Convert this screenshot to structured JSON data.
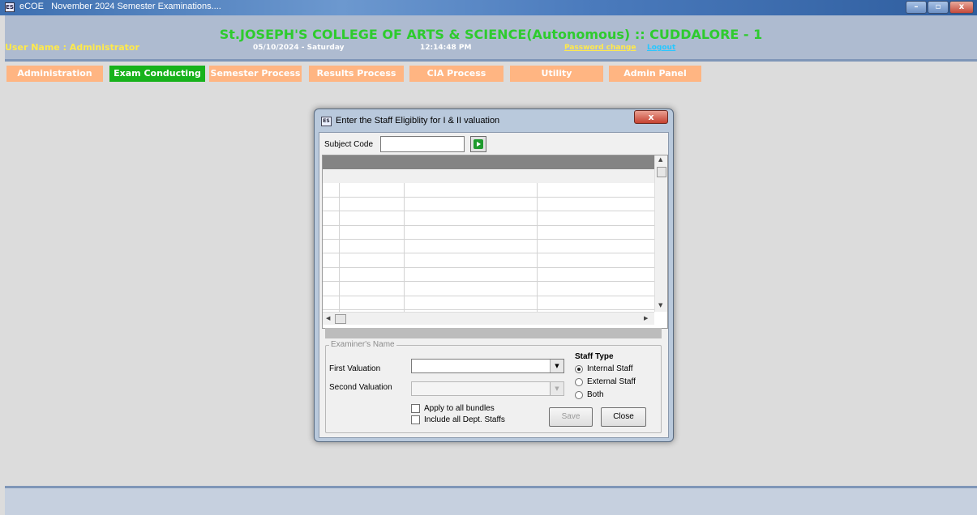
{
  "window": {
    "app_name": "eCOE",
    "title": "November 2024 Semester Examinations....",
    "buttons": [
      "–",
      "▫",
      "x"
    ]
  },
  "header": {
    "college": "St.JOSEPH'S COLLEGE OF ARTS & SCIENCE(Autonomous) :: CUDDALORE - 1",
    "user": "User Name : Administrator",
    "date": "05/10/2024 - Saturday",
    "time": "12:14:48 PM",
    "password_link": "Password change",
    "logout_link": "Logout"
  },
  "menu": [
    {
      "label": "Administration"
    },
    {
      "label": "Exam Conducting",
      "active": true
    },
    {
      "label": "Semester Process"
    },
    {
      "label": "Results Process"
    },
    {
      "label": "CIA Process"
    },
    {
      "label": "Utility"
    },
    {
      "label": "Admin Panel"
    }
  ],
  "dialog": {
    "title": "Enter the Staff Eligiblity for I & II valuation",
    "close_label": "x",
    "subject_code_label": "Subject Code",
    "subject_code_value": "",
    "examiner_group_label": "Examiner's Name",
    "first_valuation_label": "First Valuation",
    "second_valuation_label": "Second Valuation",
    "first_valuation_value": "",
    "second_valuation_value": "",
    "staff_type_label": "Staff Type",
    "staff_types": [
      "Internal Staff",
      "External Staff",
      "Both"
    ],
    "staff_type_selected": "Internal Staff",
    "apply_all_label": "Apply to all bundles",
    "include_dept_label": "Include all  Dept. Staffs",
    "save_label": "Save",
    "close_button_label": "Close"
  },
  "colors": {
    "college": "#2ecb2e",
    "user": "#ffe94a",
    "menu": "#ffb582",
    "menu_active": "#17b21b"
  }
}
